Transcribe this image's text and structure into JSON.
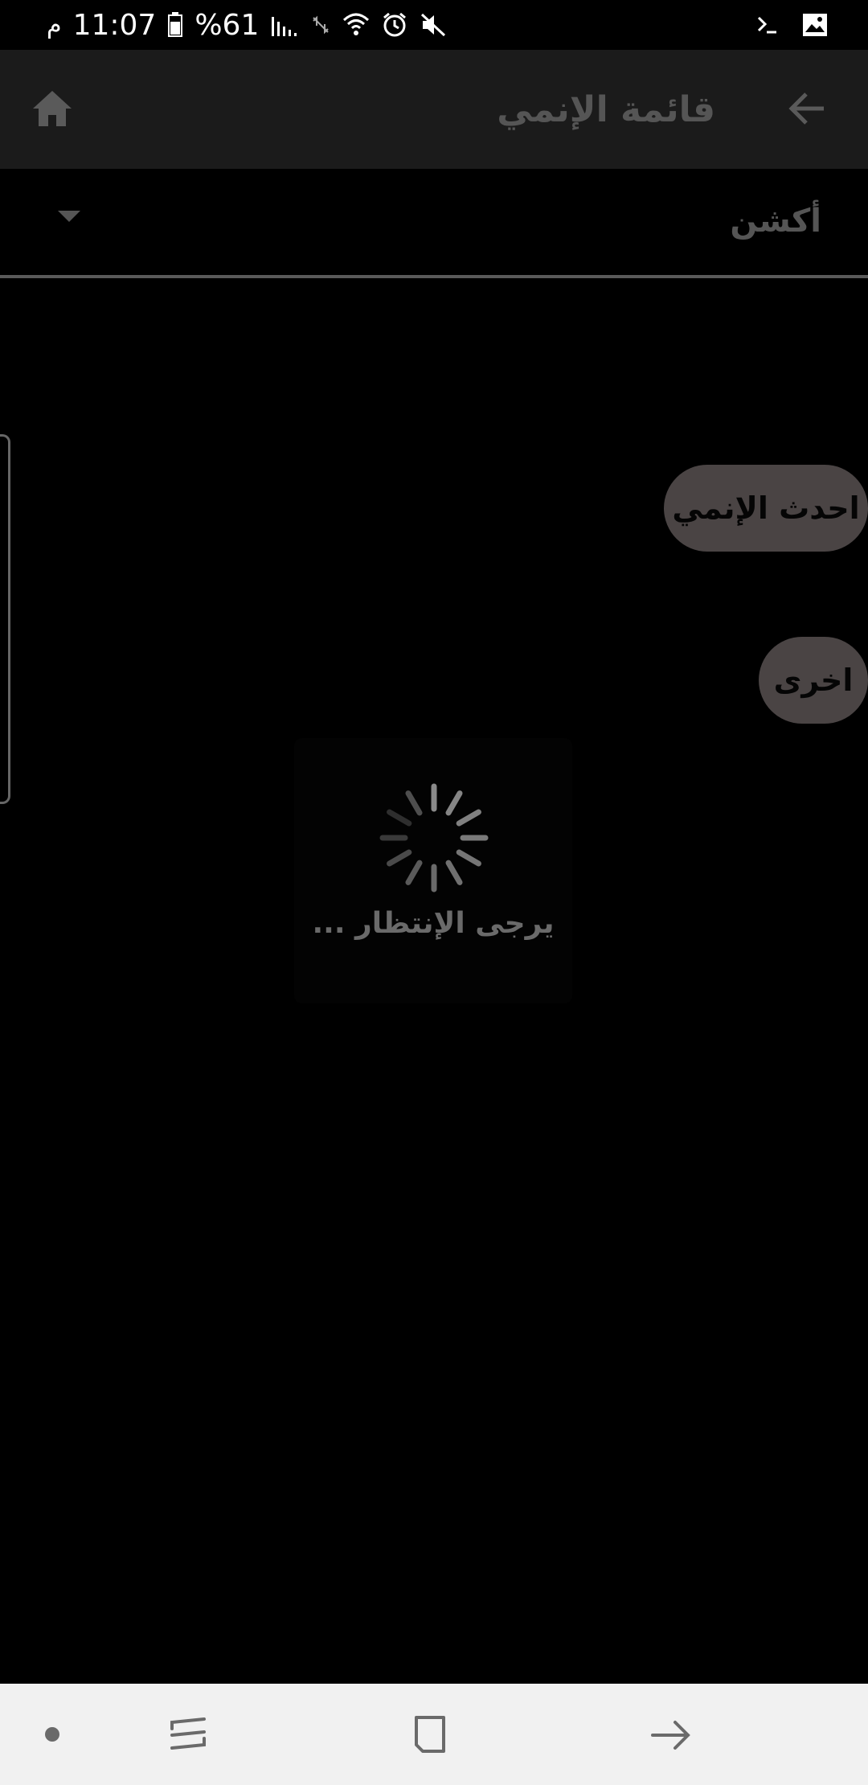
{
  "status_bar": {
    "carrier_glyph": "م",
    "time": "11:07",
    "battery": "%61"
  },
  "app_bar": {
    "title": "قائمة الإنمي"
  },
  "dropdown": {
    "selected": "أكشن"
  },
  "buttons": {
    "latest": "احدث الإنمي",
    "other": "اخرى"
  },
  "loading": {
    "text": "يرجى الإنتظار ..."
  },
  "colors": {
    "background": "#000000",
    "app_bar": "#1b1b1b",
    "pill": "#4a4444",
    "muted_text": "#555555",
    "nav_bar": "#f1f1f1"
  },
  "icons": {
    "home": "home-icon",
    "back": "arrow-back-icon",
    "dropdown": "dropdown-caret-icon",
    "spinner": "loading-spinner-icon",
    "nav_recents": "recents-icon",
    "nav_home": "nav-home-icon",
    "nav_back": "nav-back-icon"
  }
}
